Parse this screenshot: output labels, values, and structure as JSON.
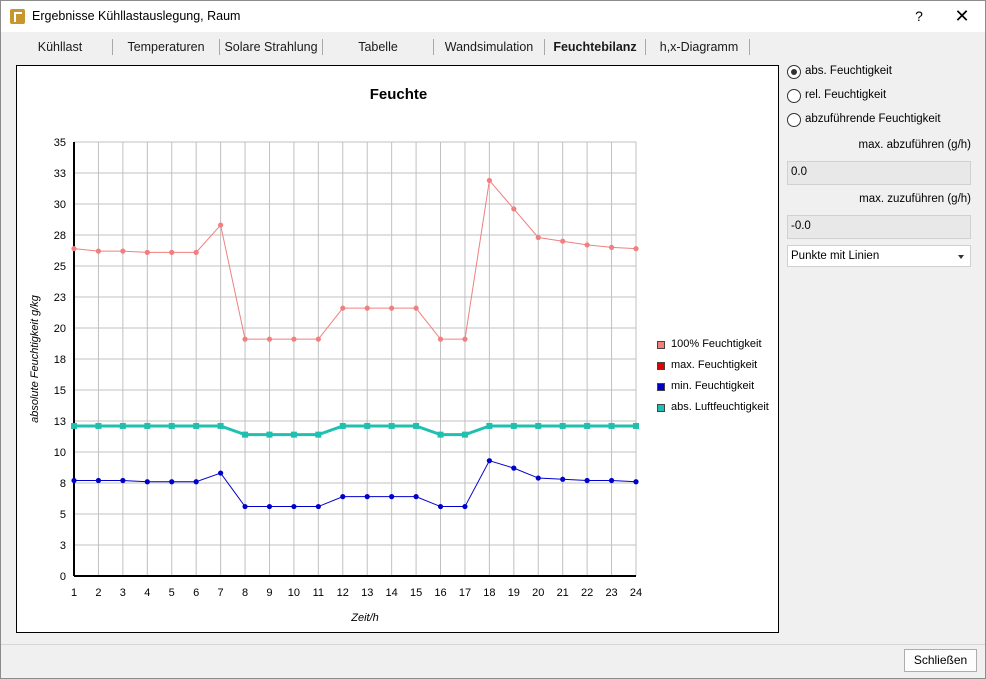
{
  "window": {
    "title": "Ergebnisse Kühllastauslegung, Raum",
    "help": "?",
    "close": "✕"
  },
  "tabs": [
    {
      "label": "Kühllast"
    },
    {
      "label": "Temperaturen"
    },
    {
      "label": "Solare Strahlung"
    },
    {
      "label": "Tabelle"
    },
    {
      "label": "Wandsimulation"
    },
    {
      "label": "Feuchtebilanz"
    },
    {
      "label": "h,x-Diagramm"
    }
  ],
  "active_tab": "Feuchtebilanz",
  "side": {
    "radios": [
      {
        "label": "abs. Feuchtigkeit",
        "checked": true
      },
      {
        "label": "rel. Feuchtigkeit",
        "checked": false
      },
      {
        "label": "abzuführende Feuchtigkeit",
        "checked": false
      }
    ],
    "max_abzufuehren_label": "max. abzuführen (g/h)",
    "max_abzufuehren_value": "0.0",
    "max_zuzufuehren_label": "max. zuzuführen (g/h)",
    "max_zuzufuehren_value": "-0.0",
    "display_mode": "Punkte mit Linien"
  },
  "footer": {
    "close_label": "Schließen"
  },
  "chart_data": {
    "type": "line",
    "title": "Feuchte",
    "xlabel": "Zeit/h",
    "ylabel": "absolute Feuchtigkeit g/kg",
    "x": [
      1,
      2,
      3,
      4,
      5,
      6,
      7,
      8,
      9,
      10,
      11,
      12,
      13,
      14,
      15,
      16,
      17,
      18,
      19,
      20,
      21,
      22,
      23,
      24
    ],
    "ylim": [
      0,
      35
    ],
    "yticks": [
      "0",
      "3",
      "5",
      "8",
      "10",
      "13",
      "15",
      "18",
      "20",
      "23",
      "25",
      "28",
      "30",
      "33",
      "35"
    ],
    "grid": true,
    "legend_position": "right",
    "series": [
      {
        "name": "100% Feuchtigkeit",
        "color": "#f08080",
        "values": [
          26.4,
          26.2,
          26.2,
          26.1,
          26.1,
          26.1,
          28.3,
          19.1,
          19.1,
          19.1,
          19.1,
          21.6,
          21.6,
          21.6,
          21.6,
          19.1,
          19.1,
          31.9,
          29.6,
          27.3,
          27.0,
          26.7,
          26.5,
          26.4
        ]
      },
      {
        "name": "max. Feuchtigkeit",
        "color": "#e00000",
        "values": []
      },
      {
        "name": "min. Feuchtigkeit",
        "color": "#0000cc",
        "values": [
          7.7,
          7.7,
          7.7,
          7.6,
          7.6,
          7.6,
          8.3,
          5.6,
          5.6,
          5.6,
          5.6,
          6.4,
          6.4,
          6.4,
          6.4,
          5.6,
          5.6,
          9.3,
          8.7,
          7.9,
          7.8,
          7.7,
          7.7,
          7.6
        ]
      },
      {
        "name": "abs. Luftfeuchtigkeit",
        "color": "#20c0b0",
        "values": [
          12.1,
          12.1,
          12.1,
          12.1,
          12.1,
          12.1,
          12.1,
          11.4,
          11.4,
          11.4,
          11.4,
          12.1,
          12.1,
          12.1,
          12.1,
          11.4,
          11.4,
          12.1,
          12.1,
          12.1,
          12.1,
          12.1,
          12.1,
          12.1
        ]
      }
    ]
  }
}
